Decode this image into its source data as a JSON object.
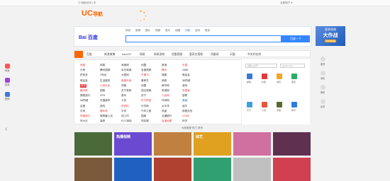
{
  "topbar": {
    "left": "◎ 轻松访问 | 中",
    "right": "当前用户 ▾"
  },
  "left_rail": [
    {
      "label": "淘宝",
      "icon": "taobao-icon",
      "color": "#f55"
    },
    {
      "label": "游戏",
      "icon": "game-icon",
      "color": "#a040e0"
    },
    {
      "label": "视频",
      "icon": "video-icon",
      "color": "#3a7bd5"
    }
  ],
  "brand": {
    "logo": "UC",
    "name": "导航"
  },
  "search": {
    "tabs": [
      "网页",
      "新闻",
      "图片",
      "视频",
      "音乐",
      "地图",
      "问答",
      "百科",
      "更多"
    ],
    "active_tab": 6,
    "engine": "Bai 百度",
    "button": "百度一下"
  },
  "ad": {
    "l1": "夏季热销",
    "l2": "大作战",
    "l3": "1580新品"
  },
  "quick_nav": [
    "百度",
    "新浪微博",
    "hao123",
    "网易",
    "网易游戏",
    "优酷视频",
    "爱奇艺视频",
    "凤凰网",
    "天猫",
    "中关村在线"
  ],
  "main_links": {
    "col1": [
      "淘宝",
      "头条",
      "拼多多",
      "唯品会",
      "京东",
      "聚划算",
      "携程旅行",
      "58同城",
      "百度",
      "贝壳",
      "同城旅行",
      "好大夫"
    ],
    "col2": [
      "网易",
      "腾讯视频",
      "1号店",
      "生活服务",
      "小说大全",
      "国美",
      "OTA",
      "天猫超市",
      "游戏",
      "懂车帝",
      "搜狗输入法",
      "装修"
    ],
    "col3": [
      "淘宝网",
      "京东商城",
      "大麦网",
      "美团外卖",
      "同程",
      "苏宁易购",
      "易车",
      "卡农",
      "驴妈妈",
      "平安",
      "找工作",
      "ECC体检"
    ],
    "col4": [
      "优酷",
      "百度视频",
      "芒果TV",
      "爱奇艺",
      "优酷",
      "西瓜视频",
      "苏宁",
      "东方财富",
      "中华网",
      "汽车之家",
      "国美",
      "同花顺"
    ],
    "col5": [
      "新浪",
      "腾讯",
      "搜狐",
      "网易",
      "新华网",
      "央视网",
      "人民网",
      "环球网",
      "太平洋",
      "凤凰",
      "交通银行",
      "百度地图"
    ],
    "col6": [
      "天猫",
      "1688",
      "唯品会",
      "58同城",
      "游戏",
      "安居客",
      "智联",
      "美团",
      "途牛",
      "前程无忧",
      "12306",
      "好评"
    ]
  },
  "right_panel": {
    "input1": "请输入文字",
    "input2": "qipono.com",
    "icons": [
      {
        "label": "邮箱",
        "icon": "mail-icon",
        "color": "#3a7bd5"
      },
      {
        "label": "彩票",
        "icon": "lottery-icon",
        "color": "#e4393c"
      },
      {
        "label": "游戏",
        "icon": "game-icon",
        "color": "#f5a623"
      },
      {
        "label": "首页",
        "icon": "home-icon",
        "color": "#27ae60"
      },
      {
        "label": "天气",
        "icon": "weather-icon",
        "color": "#3aa0e0"
      },
      {
        "label": "小说",
        "icon": "novel-icon",
        "color": "#e05a3a"
      },
      {
        "label": "军事",
        "icon": "military-icon",
        "color": "#556b2f"
      },
      {
        "label": "体育",
        "icon": "sports-icon",
        "color": "#2d7be0"
      }
    ]
  },
  "side_tools": [
    {
      "label": "置顶",
      "icon": "pin-icon",
      "color": "#ddd"
    },
    {
      "label": "添加",
      "icon": "add-icon",
      "color": "#ddd"
    },
    {
      "label": "换肤",
      "icon": "skin-icon",
      "color": "#ddd"
    },
    {
      "label": "反馈",
      "icon": "feedback-icon",
      "color": "#ddd"
    }
  ],
  "feed": {
    "header": "为你推荐  热门  资讯",
    "tiles": [
      {
        "caption": "",
        "color": "#4a6a3a"
      },
      {
        "caption": "热播视频",
        "color": "#6a4ad0"
      },
      {
        "caption": "",
        "color": "#c08040"
      },
      {
        "caption": "综艺",
        "color": "#e0a020"
      },
      {
        "caption": "",
        "color": "#d070a0"
      },
      {
        "caption": "",
        "color": "#603050"
      },
      {
        "caption": "",
        "color": "#7a5a3a"
      },
      {
        "caption": "",
        "color": "#2060c0"
      },
      {
        "caption": "",
        "color": "#b04030"
      },
      {
        "caption": "",
        "color": "#30a070"
      },
      {
        "caption": "",
        "color": "#c0c0c0"
      },
      {
        "caption": "",
        "color": "#d04050"
      }
    ]
  }
}
